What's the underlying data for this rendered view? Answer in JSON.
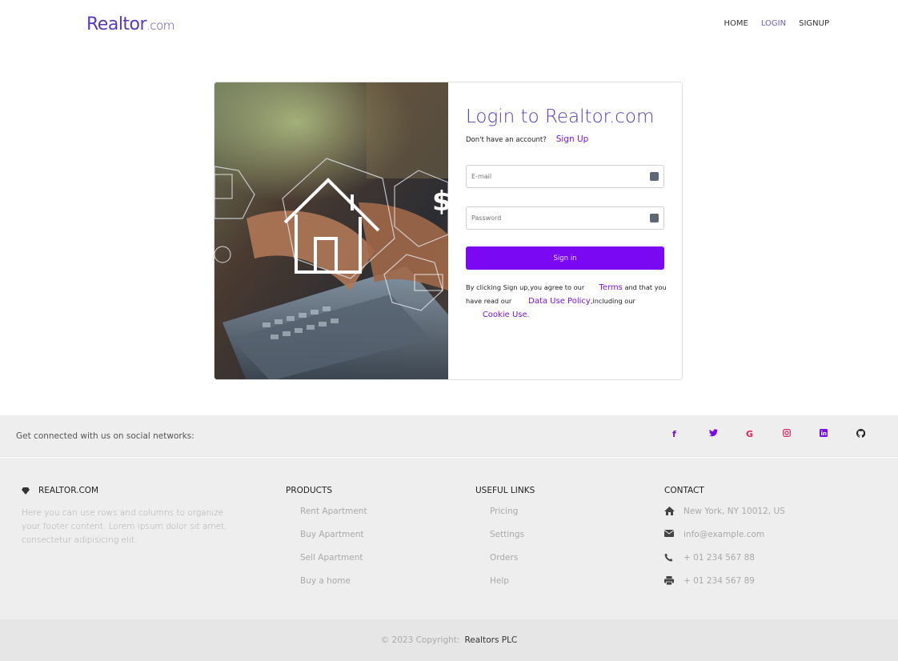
{
  "brand": {
    "main": "Realtor",
    "suffix": ".com"
  },
  "nav": {
    "items": [
      "HOME",
      "LOGIN",
      "SIGNUP"
    ]
  },
  "login": {
    "title": "Login to Realtor.com",
    "no_account_text": "Don't have an account?",
    "signup_link": "Sign Up",
    "email_placeholder": "E-mail",
    "password_placeholder": "Password",
    "signin_label": "Sign in",
    "terms_prefix": "By clicking Sign up,you agree to our",
    "terms_link": "Terms",
    "terms_mid": "and that you have read our",
    "data_policy_link": "Data Use Policy",
    "terms_mid2": ",including our",
    "cookie_link": "Cookie Use",
    "terms_end": "."
  },
  "social": {
    "text": "Get connected with us on social networks:",
    "icons": [
      "facebook-icon",
      "twitter-icon",
      "google-icon",
      "instagram-icon",
      "linkedin-icon",
      "github-icon"
    ],
    "glyphs": [
      "f",
      "🐦",
      "G",
      "◎",
      "in",
      "◯"
    ]
  },
  "footer": {
    "about": {
      "heading": "REALTOR.COM",
      "text": "Here you can use rows and columns to organize your footer content. Lorem ipsum dolor sit amet, consectetur adipisicing elit."
    },
    "products": {
      "heading": "PRODUCTS",
      "items": [
        "Rent Apartment",
        "Buy Apartment",
        "Sell Apartment",
        "Buy a home"
      ]
    },
    "useful_links": {
      "heading": "USEFUL LINKS",
      "items": [
        "Pricing",
        "Settings",
        "Orders",
        "Help"
      ]
    },
    "contact": {
      "heading": "CONTACT",
      "items": [
        {
          "icon": "home-icon",
          "text": "New York, NY 10012, US"
        },
        {
          "icon": "envelope-icon",
          "text": "info@example.com"
        },
        {
          "icon": "phone-icon",
          "text": "+ 01 234 567 88"
        },
        {
          "icon": "print-icon",
          "text": "+ 01 234 567 89"
        }
      ]
    }
  },
  "copyright": {
    "text": "© 2023 Copyright:",
    "owner": "Realtors PLC"
  },
  "colors": {
    "accent": "#7a08f3",
    "brand": "#5a3bb5",
    "footer_bg": "#eeeeee"
  }
}
